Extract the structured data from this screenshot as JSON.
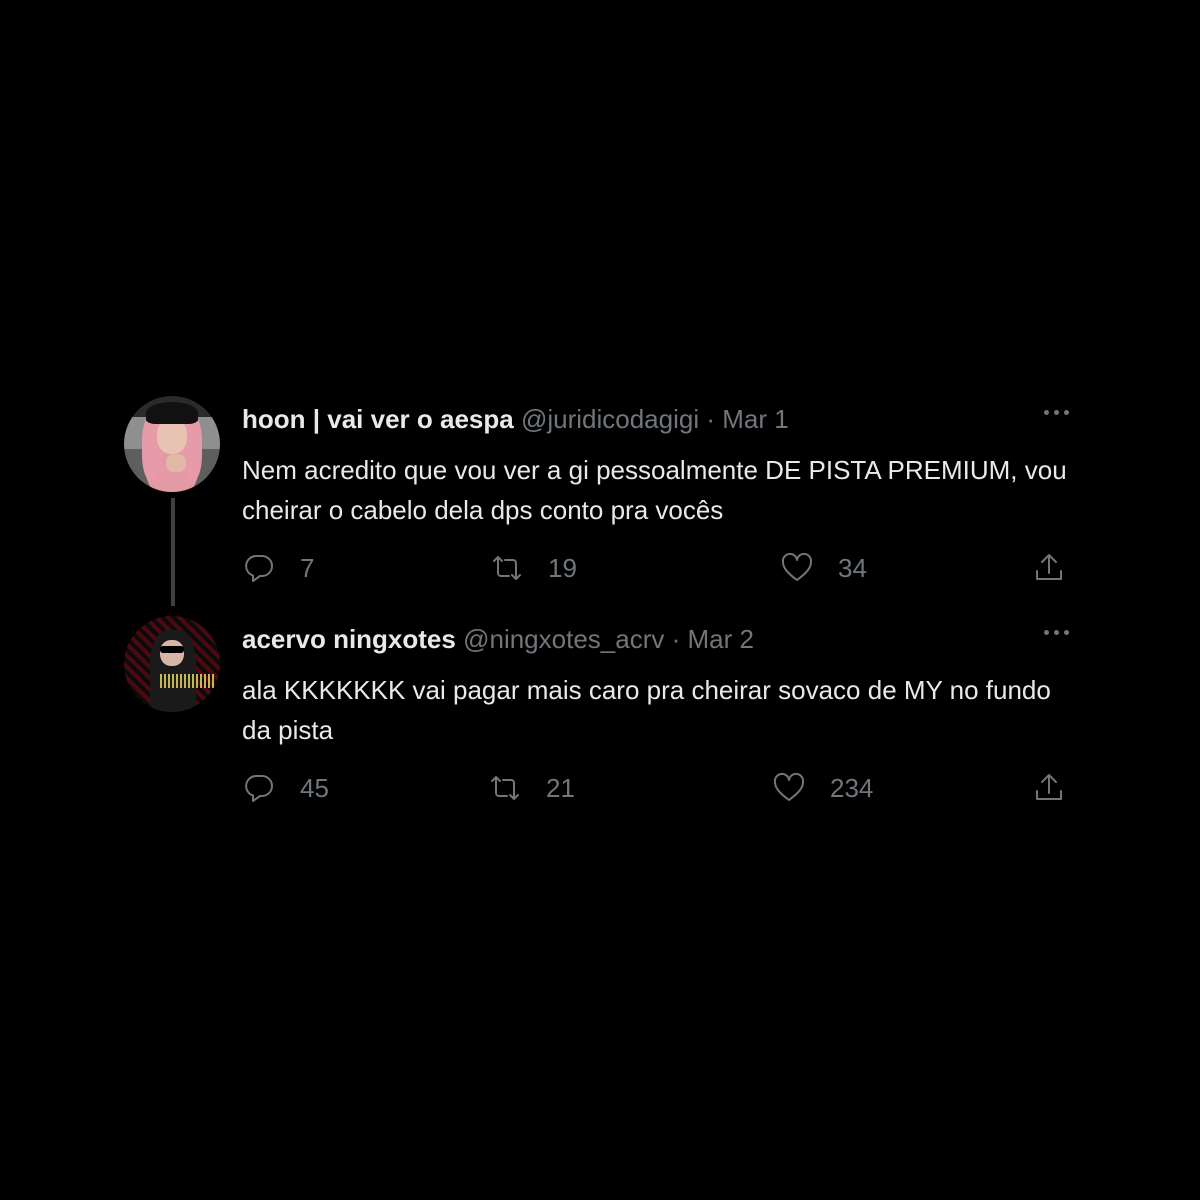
{
  "tweets": [
    {
      "name": "hoon | vai ver o aespa",
      "handle": "@juridicodagigi",
      "separator": "·",
      "date": "Mar 1",
      "text": "Nem acredito que vou ver a gi pessoalmente DE PISTA PREMIUM, vou cheirar o cabelo dela dps conto pra vocês",
      "replies": "7",
      "retweets": "19",
      "likes": "34"
    },
    {
      "name": "acervo ningxotes",
      "handle": "@ningxotes_acrv",
      "separator": "·",
      "date": "Mar 2",
      "text": "ala KKKKKKK vai pagar mais caro pra cheirar sovaco de MY no fundo da pista",
      "replies": "45",
      "retweets": "21",
      "likes": "234"
    }
  ],
  "colors": {
    "background": "#000000",
    "primary_text": "#e7e9ea",
    "secondary_text": "#71767b",
    "thread_line": "#3e4144"
  },
  "icons": {
    "reply": "reply-icon",
    "retweet": "retweet-icon",
    "like": "heart-icon",
    "share": "share-icon",
    "more": "more-icon"
  }
}
